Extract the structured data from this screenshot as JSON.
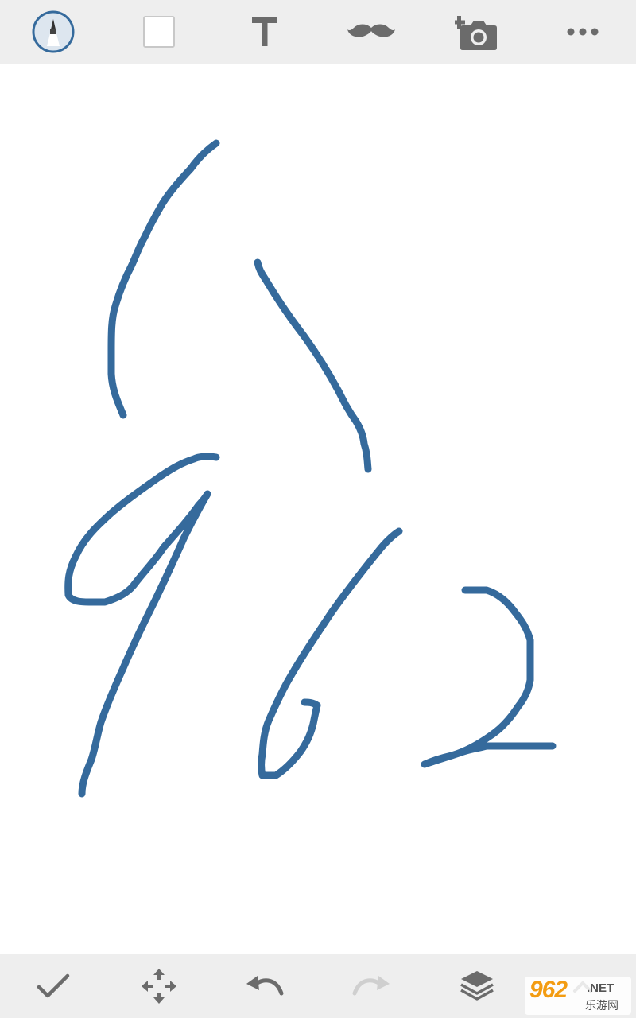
{
  "toolbar_top": {
    "items": [
      {
        "name": "brush-tool",
        "icon": "brush-icon",
        "selected": true
      },
      {
        "name": "sticker-tool",
        "icon": "blank-square-icon"
      },
      {
        "name": "text-tool",
        "icon": "text-icon",
        "label": "T"
      },
      {
        "name": "mustache-tool",
        "icon": "mustache-icon"
      },
      {
        "name": "add-photo-tool",
        "icon": "add-photo-icon"
      },
      {
        "name": "more-tool",
        "icon": "more-dots-icon"
      }
    ]
  },
  "toolbar_bottom": {
    "items": [
      {
        "name": "done-button",
        "icon": "check-icon"
      },
      {
        "name": "move-button",
        "icon": "move-arrows-icon"
      },
      {
        "name": "undo-button",
        "icon": "undo-icon"
      },
      {
        "name": "redo-button",
        "icon": "redo-icon",
        "disabled": true
      },
      {
        "name": "layers-button",
        "icon": "layers-icon"
      },
      {
        "name": "expand-button",
        "icon": "chevron-up-icon"
      }
    ]
  },
  "canvas": {
    "stroke_color": "#356a9c",
    "background": "#ffffff"
  },
  "colors": {
    "toolbar_bg": "#eeeeee",
    "icon": "#6b6b6b",
    "icon_disabled": "#cfcfcf",
    "selected_ring": "#356a9c"
  },
  "watermark": {
    "logo": "962",
    "domain": ".NET",
    "cn": "乐游网"
  }
}
